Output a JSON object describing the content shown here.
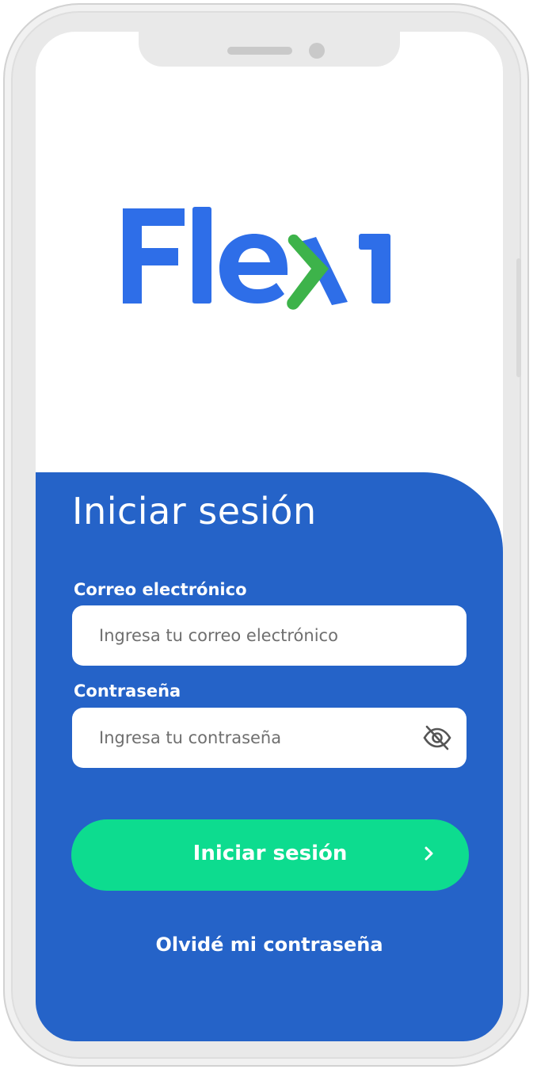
{
  "brand": {
    "logo_text": "Flexi",
    "primary_color": "#2563c8",
    "accent_color": "#3db34a"
  },
  "login": {
    "title": "Iniciar sesión",
    "email_label": "Correo electrónico",
    "email_placeholder": "Ingresa tu correo electrónico",
    "password_label": "Contraseña",
    "password_placeholder": "Ingresa tu contraseña",
    "password_toggle_icon": "eye-off-icon",
    "submit_label": "Iniciar sesión",
    "submit_icon": "chevron-right-icon",
    "submit_color": "#0ddc8f",
    "forgot_label": "Olvidé mi contraseña"
  }
}
